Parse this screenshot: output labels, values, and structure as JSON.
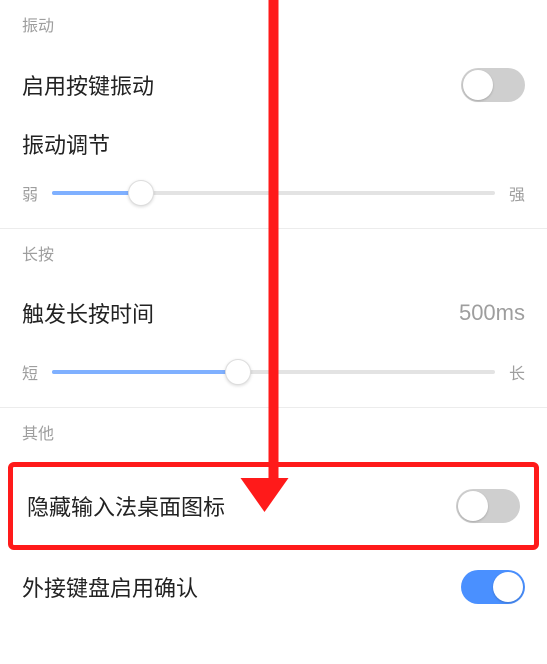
{
  "vibration": {
    "header": "振动",
    "enable_label": "启用按键振动",
    "enable_value": false,
    "adjust_label": "振动调节",
    "slider_min_label": "弱",
    "slider_max_label": "强",
    "slider_percent": 20
  },
  "longpress": {
    "header": "长按",
    "trigger_label": "触发长按时间",
    "trigger_value": "500ms",
    "slider_min_label": "短",
    "slider_max_label": "长",
    "slider_percent": 42
  },
  "other": {
    "header": "其他",
    "hide_icon_label": "隐藏输入法桌面图标",
    "hide_icon_value": false,
    "external_kb_label": "外接键盘启用确认",
    "external_kb_value": true
  },
  "colors": {
    "accent": "#4a90ff",
    "highlight": "#ff1a1a"
  }
}
